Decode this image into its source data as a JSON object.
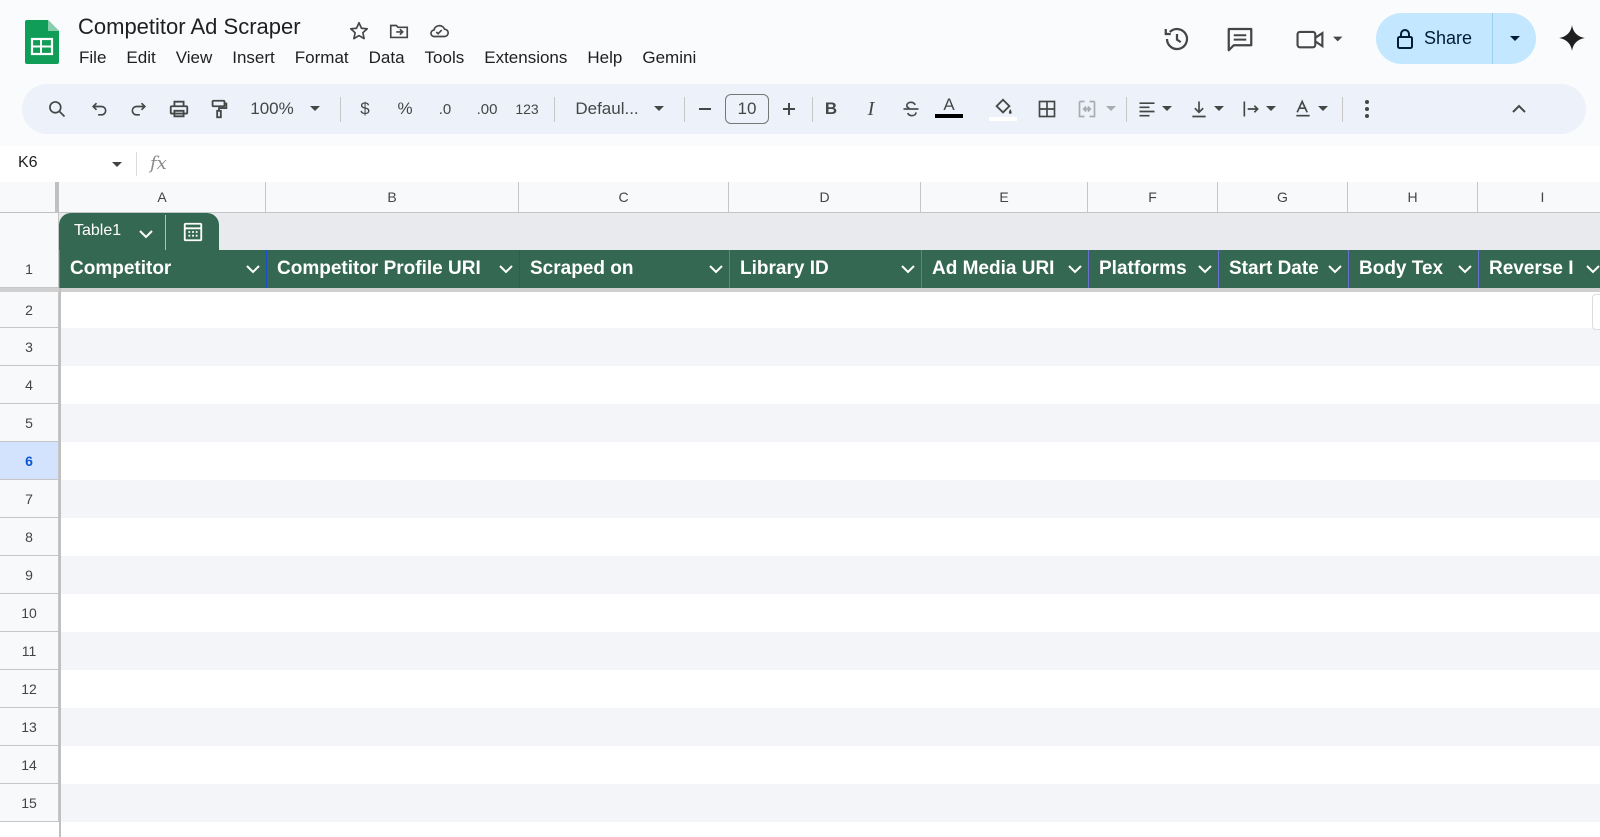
{
  "app": {
    "title": "Competitor Ad Scraper",
    "menu": [
      "File",
      "Edit",
      "View",
      "Insert",
      "Format",
      "Data",
      "Tools",
      "Extensions",
      "Help",
      "Gemini"
    ],
    "share_label": "Share",
    "accent": "#c2e7ff",
    "brand_green": "#0f9d58"
  },
  "toolbar": {
    "zoom": "100%",
    "currency": "$",
    "percent": "%",
    "dec_decrease": ".0",
    "dec_increase": ".00",
    "number_format": "123",
    "font": "Defaul...",
    "font_size": "10",
    "bold": "B",
    "italic": "I",
    "text_color": "A"
  },
  "formula_bar": {
    "cell_ref": "K6",
    "fx": "fx",
    "value": ""
  },
  "sheet": {
    "columns": [
      "A",
      "B",
      "C",
      "D",
      "E",
      "F",
      "G",
      "H",
      "I"
    ],
    "rows": [
      "1",
      "2",
      "3",
      "4",
      "5",
      "6",
      "7",
      "8",
      "9",
      "10",
      "11",
      "12",
      "13",
      "14",
      "15"
    ],
    "selected_row": "6",
    "table_name": "Table1",
    "table_color": "#356853",
    "headers": [
      "Competitor",
      "Competitor Profile URI",
      "Scraped on",
      "Library ID",
      "Ad Media URI",
      "Platforms",
      "Start Date",
      "Body Tex",
      "Reverse I"
    ]
  }
}
